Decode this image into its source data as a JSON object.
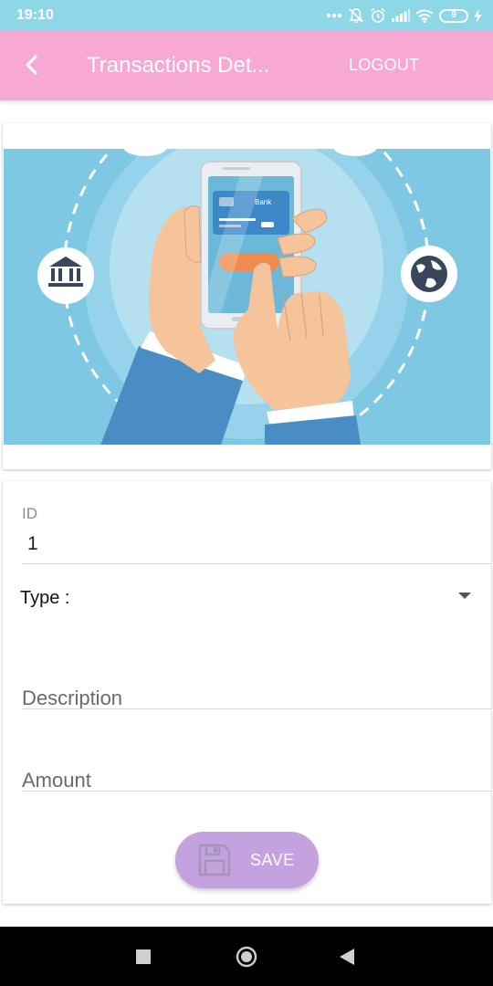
{
  "status_bar": {
    "time": "19:10",
    "battery_level": "9",
    "icons": [
      "more-dots-icon",
      "bell-off-icon",
      "alarm-icon",
      "signal-icon",
      "wifi-icon",
      "battery-icon",
      "charging-icon"
    ]
  },
  "app_bar": {
    "title": "Transactions Det...",
    "logout_label": "LOGOUT",
    "back_icon": "chevron-left-icon"
  },
  "illustration": {
    "card_label": "Bank"
  },
  "form": {
    "id_label": "ID",
    "id_value": "1",
    "type_label": "Type :",
    "type_value": "",
    "description_placeholder": "Description",
    "description_value": "",
    "amount_placeholder": "Amount",
    "amount_value": "",
    "save_label": "SAVE"
  },
  "colors": {
    "status_bar": "#8ed7e7",
    "app_bar": "#f7a8d5",
    "save_button": "#c3a2df",
    "illustration_bg": "#7ec8e3"
  },
  "nav_bar": {
    "icons": [
      "square-recents-icon",
      "circle-home-icon",
      "triangle-back-icon"
    ]
  }
}
